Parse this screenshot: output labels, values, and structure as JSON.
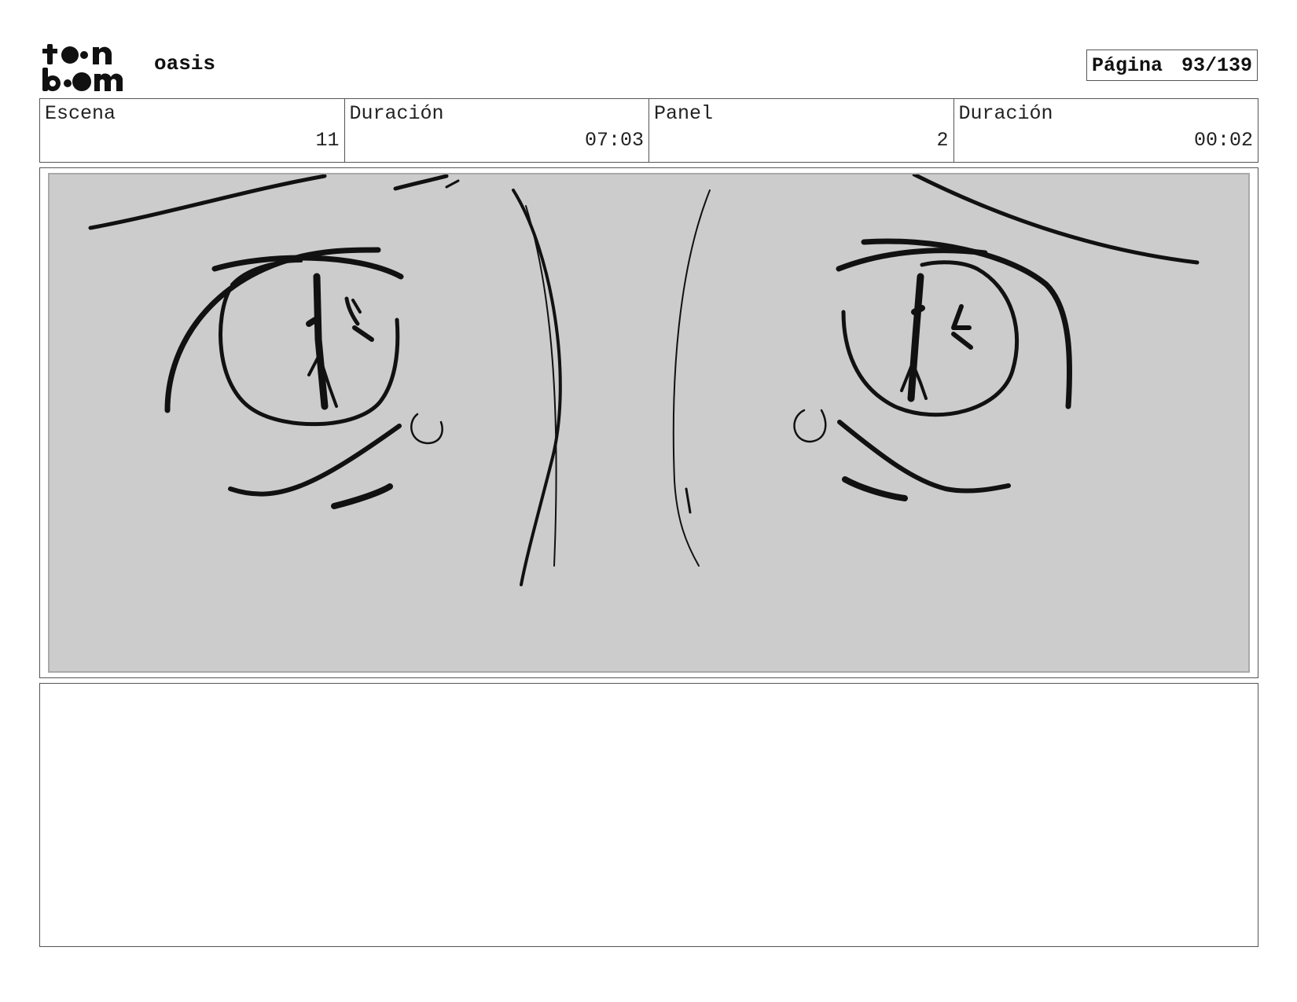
{
  "header": {
    "logo_text": "toon boom",
    "project_name": "oasis",
    "page_label": "Página",
    "page_value": "93/139"
  },
  "info": {
    "scene_label": "Escena",
    "scene_value": "11",
    "scene_duration_label": "Duración",
    "scene_duration_value": "07:03",
    "panel_label": "Panel",
    "panel_value": "2",
    "panel_duration_label": "Duración",
    "panel_duration_value": "00:02"
  },
  "notes": {
    "text": ""
  }
}
